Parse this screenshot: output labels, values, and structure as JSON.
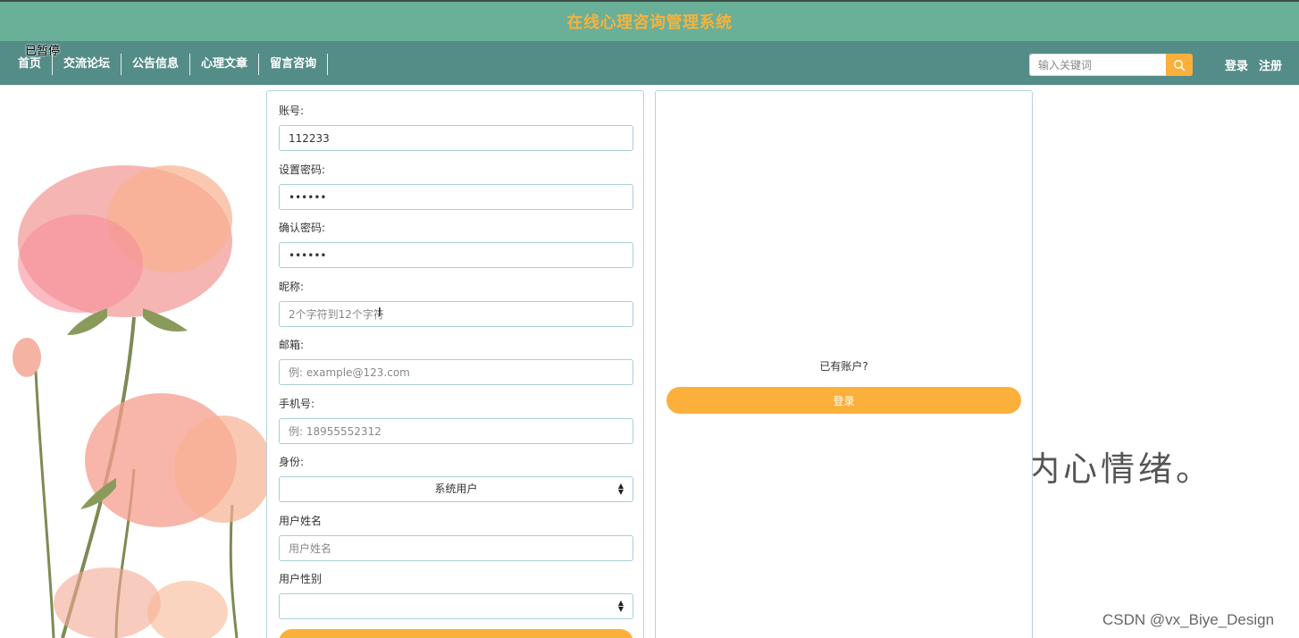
{
  "header": {
    "title": "在线心理咨询管理系统"
  },
  "overlay": {
    "paused": "已暂停"
  },
  "nav": {
    "items": [
      "首页",
      "交流论坛",
      "公告信息",
      "心理文章",
      "留言咨询"
    ]
  },
  "search": {
    "placeholder": "输入关键词",
    "icon": "search-icon"
  },
  "auth": {
    "login": "登录",
    "register": "注册"
  },
  "form": {
    "account": {
      "label": "账号:",
      "value": "112233"
    },
    "password": {
      "label": "设置密码:",
      "value": "••••••"
    },
    "confirm_password": {
      "label": "确认密码:",
      "value": "••••••"
    },
    "nickname": {
      "label": "昵称:",
      "placeholder": "2个字符到12个字符"
    },
    "email": {
      "label": "邮箱:",
      "placeholder": "例: example@123.com"
    },
    "phone": {
      "label": "手机号:",
      "placeholder": "例: 18955552312"
    },
    "role": {
      "label": "身份:",
      "value": "系统用户"
    },
    "real_name": {
      "label": "用户姓名",
      "placeholder": "用户姓名"
    },
    "gender": {
      "label": "用户性别",
      "value": ""
    }
  },
  "login_panel": {
    "prompt": "已有账户?",
    "button": "登录"
  },
  "background": {
    "text": "内心情绪。"
  },
  "watermark": "CSDN @vx_Biye_Design",
  "colors": {
    "header_bg": "#6aaf98",
    "nav_bg": "#548c88",
    "accent": "#fbb03b",
    "title": "#f7b23b"
  }
}
